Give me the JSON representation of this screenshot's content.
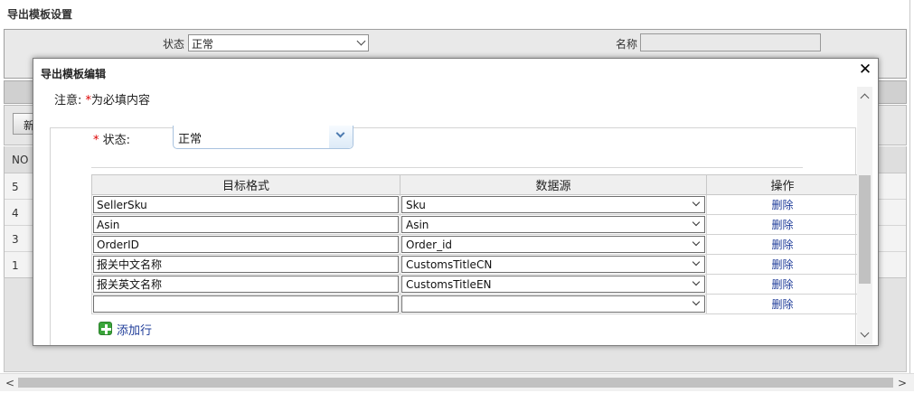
{
  "page": {
    "title": "导出模板设置"
  },
  "search": {
    "status_label": "状态",
    "status_value": "正常",
    "name_label": "名称",
    "name_value": ""
  },
  "grid": {
    "new_button": "新",
    "header_no": "NO",
    "rows": [
      "5",
      "4",
      "3",
      "1"
    ]
  },
  "modal": {
    "title": "导出模板编辑",
    "close_icon": "close-icon",
    "notice_prefix": "注意:",
    "notice_star": "*",
    "notice_text": "为必填内容",
    "status_star": "*",
    "status_label": " 状态:",
    "status_value": "正常",
    "columns": {
      "target": "目标格式",
      "source": "数据源",
      "op": "操作"
    },
    "rows": [
      {
        "target": "SellerSku",
        "source": "Sku",
        "op": "删除"
      },
      {
        "target": "Asin",
        "source": "Asin",
        "op": "删除"
      },
      {
        "target": "OrderID",
        "source": "Order_id",
        "op": "删除"
      },
      {
        "target": "报关中文名称",
        "source": "CustomsTitleCN",
        "op": "删除"
      },
      {
        "target": "报关英文名称",
        "source": "CustomsTitleEN",
        "op": "删除"
      },
      {
        "target": "",
        "source": "",
        "op": "删除"
      }
    ],
    "add_row_label": "添加行",
    "add_row_icon": "plus-icon"
  },
  "colors": {
    "link": "#1f3c99",
    "required": "#dd0000",
    "add_icon": "#3aa53a"
  }
}
